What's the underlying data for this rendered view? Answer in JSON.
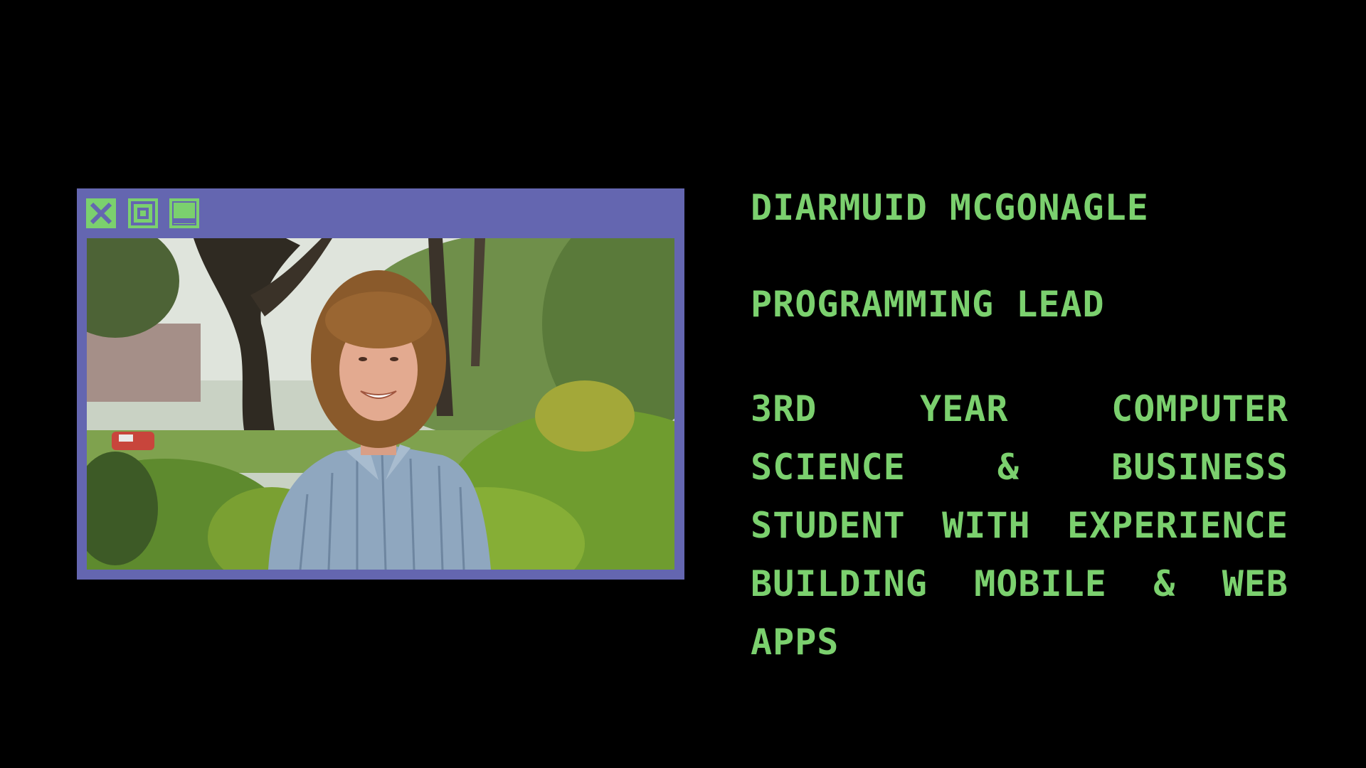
{
  "colors": {
    "background": "#000000",
    "accent_green": "#7bd06e",
    "window_frame": "#6466b0"
  },
  "window": {
    "buttons": [
      {
        "icon": "close-icon"
      },
      {
        "icon": "maximize-icon"
      },
      {
        "icon": "minimize-icon"
      }
    ],
    "photo_subject": "person-photo"
  },
  "profile": {
    "name": "DIARMUID MCGONAGLE",
    "role": "PROGRAMMING LEAD",
    "bio": "3RD YEAR COMPUTER SCIENCE & BUSINESS STUDENT WITH EXPERIENCE BUILDING MOBILE & WEB APPS"
  }
}
